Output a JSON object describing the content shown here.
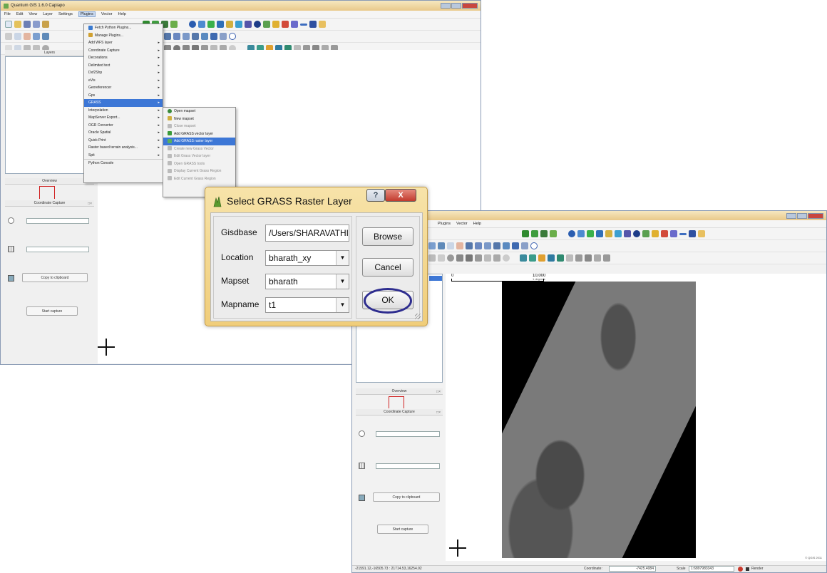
{
  "win1": {
    "title": "Quantum GIS 1.6.0 Capiapo",
    "menus": [
      "File",
      "Edit",
      "View",
      "Layer",
      "Settings",
      "Plugins",
      "Vector",
      "Help"
    ],
    "layers_panel": "Layers",
    "overview_panel": "Overview",
    "coord_capture_panel": "Coordinate Capture",
    "copy_button": "Copy to clipboard",
    "start_button": "Start capture"
  },
  "plugins_menu": {
    "items": [
      {
        "label": "Fetch Python Plugins...",
        "submenu": false
      },
      {
        "label": "Manage Plugins...",
        "submenu": false
      },
      {
        "label": "Add WFS layer",
        "submenu": true
      },
      {
        "label": "Coordinate Capture",
        "submenu": true
      },
      {
        "label": "Decorations",
        "submenu": true
      },
      {
        "label": "Delimited text",
        "submenu": true
      },
      {
        "label": "Dxf2Shp",
        "submenu": true
      },
      {
        "label": "eVis",
        "submenu": true
      },
      {
        "label": "Georeferencer",
        "submenu": true
      },
      {
        "label": "Gps",
        "submenu": true
      },
      {
        "label": "GRASS",
        "submenu": true,
        "highlighted": true
      },
      {
        "label": "Interpolation",
        "submenu": true
      },
      {
        "label": "MapServer Export...",
        "submenu": true
      },
      {
        "label": "OGR Converter",
        "submenu": true
      },
      {
        "label": "Oracle Spatial",
        "submenu": true
      },
      {
        "label": "Quick Print",
        "submenu": true
      },
      {
        "label": "Raster based terrain analysis...",
        "submenu": true
      },
      {
        "label": "Spit",
        "submenu": true
      },
      {
        "label": "Python Console",
        "submenu": false
      }
    ]
  },
  "grass_submenu": {
    "items": [
      {
        "label": "Open mapset",
        "dim": false
      },
      {
        "label": "New mapset",
        "dim": false
      },
      {
        "label": "Close mapset",
        "dim": true
      },
      {
        "label": "Add GRASS vector layer",
        "dim": false
      },
      {
        "label": "Add GRASS raster layer",
        "dim": false,
        "highlighted": true
      },
      {
        "label": "Create new Grass Vector",
        "dim": true
      },
      {
        "label": "Edit Grass Vector layer",
        "dim": true
      },
      {
        "label": "Open GRASS tools",
        "dim": true
      },
      {
        "label": "Display Current Grass Region",
        "dim": true
      },
      {
        "label": "Edit Current Grass Region",
        "dim": true
      }
    ]
  },
  "dialog": {
    "title": "Select GRASS Raster Layer",
    "help_glyph": "?",
    "close_glyph": "X",
    "gisdbase_label": "Gisdbase",
    "gisdbase_value": "/Users/SHARAVATHI",
    "location_label": "Location",
    "location_value": "bharath_xy",
    "mapset_label": "Mapset",
    "mapset_value": "bharath",
    "mapname_label": "Mapname",
    "mapname_value": "t1",
    "browse": "Browse",
    "cancel": "Cancel",
    "ok": "OK"
  },
  "win2": {
    "menus": [
      "Plugins",
      "Vector",
      "Help"
    ],
    "scale_left": "0",
    "scale_right": "10,000",
    "scale_unit": "1 degrees",
    "overview_panel": "Overview",
    "coord_capture_panel": "Coordinate Capture",
    "copy_button": "Copy to clipboard",
    "start_button": "Start capture",
    "copyright": "© QGIS 2011",
    "status_coords": "-21591.12,-16505.73 : 21714.53,16254.92",
    "coordinate_label": "Coordinate:",
    "coordinate_value": "-7425.4084",
    "scale_label": "Scale",
    "scale_value": "1:6897983343",
    "render_label": "Render"
  },
  "colors": {
    "menu_highlight": "#3d77d6",
    "ok_ring": "#2e2d8f",
    "raster_dark": "#000000",
    "dialog_bg": "#f0cd7a"
  }
}
